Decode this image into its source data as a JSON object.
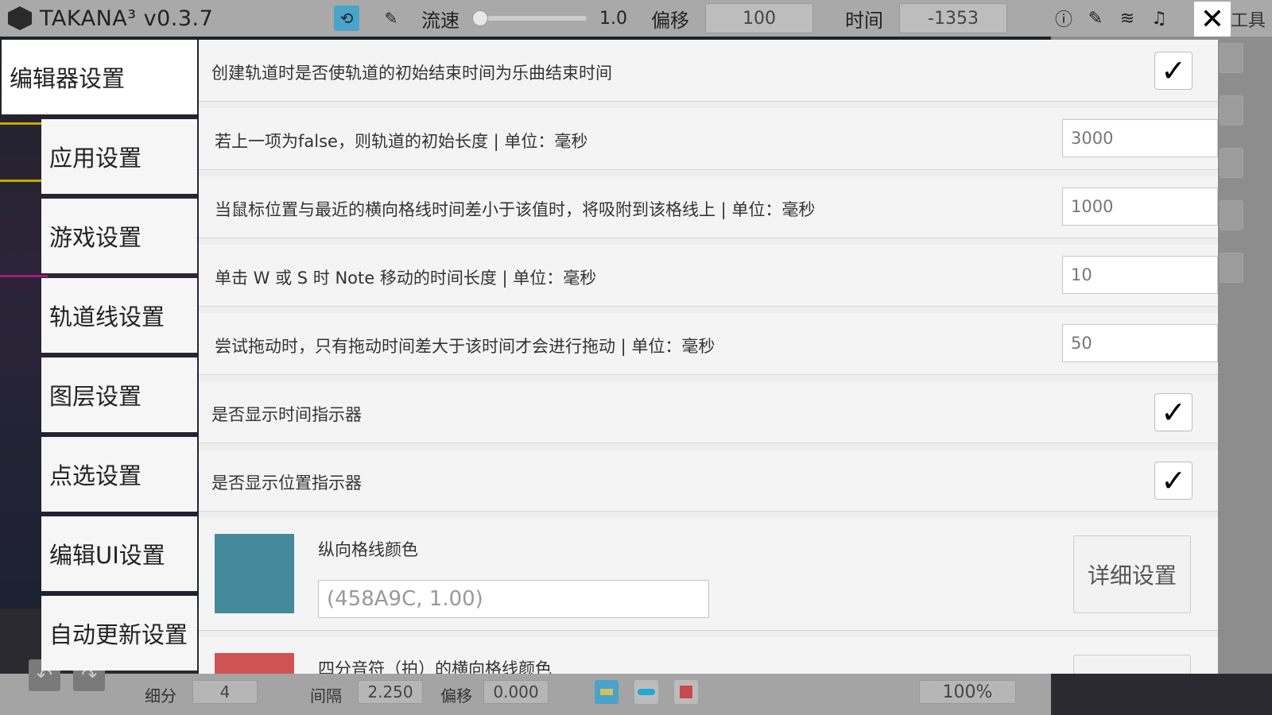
{
  "app": {
    "title": "TAKANA³ v0.3.7"
  },
  "toolbar": {
    "speed_label": "流速",
    "speed_value": "1.0",
    "speed_level": 0.0,
    "offset_label": "偏移",
    "offset_value": "100",
    "time_label": "时间",
    "time_value": "-1353",
    "tools_label": "工具",
    "icons": [
      "refresh-icon",
      "magic-wand-icon",
      "info-icon",
      "edit-icon",
      "layers-icon",
      "music-note-icon",
      "close-icon"
    ]
  },
  "settings": {
    "tabs": [
      {
        "label": "编辑器设置",
        "active": true
      },
      {
        "label": "应用设置"
      },
      {
        "label": "游戏设置"
      },
      {
        "label": "轨道线设置"
      },
      {
        "label": "图层设置"
      },
      {
        "label": "点选设置"
      },
      {
        "label": "编辑UI设置"
      },
      {
        "label": "自动更新设置"
      }
    ],
    "rows": [
      {
        "label": "创建轨道时是否使轨道的初始结束时间为乐曲结束时间",
        "type": "checkbox",
        "checked": true
      },
      {
        "label": "若上一项为false，则轨道的初始长度 | 单位：毫秒",
        "type": "number",
        "value": "3000"
      },
      {
        "label": "当鼠标位置与最近的横向格线时间差小于该值时，将吸附到该格线上 | 单位：毫秒",
        "type": "number",
        "value": "1000"
      },
      {
        "label": "单击 W 或 S 时 Note 移动的时间长度 | 单位：毫秒",
        "type": "number",
        "value": "10"
      },
      {
        "label": "尝试拖动时，只有拖动时间差大于该时间才会进行拖动 | 单位：毫秒",
        "type": "number",
        "value": "50"
      },
      {
        "label": "是否显示时间指示器",
        "type": "checkbox",
        "checked": true
      },
      {
        "label": "是否显示位置指示器",
        "type": "checkbox",
        "checked": true
      },
      {
        "label": "纵向格线颜色",
        "type": "color",
        "color": "#458A9C",
        "value": "(458A9C, 1.00)",
        "button": "详细设置"
      },
      {
        "label": "四分音符（拍）的横向格线颜色",
        "type": "color",
        "color": "#CF5353"
      }
    ],
    "checkmark": "✓"
  },
  "bottombar": {
    "subdivision_label": "细分",
    "subdivision_value": "4",
    "interval_label": "间隔",
    "interval_value": "2.250",
    "offset_label": "偏移",
    "offset_value": "0.000",
    "zoom_value": "100%",
    "undo_icon": "undo-icon",
    "redo_icon": "redo-icon",
    "colors": {
      "tool1": "#4aa3c8",
      "tool2": "#1fa9d8",
      "tool3": "#c94a4a"
    }
  }
}
